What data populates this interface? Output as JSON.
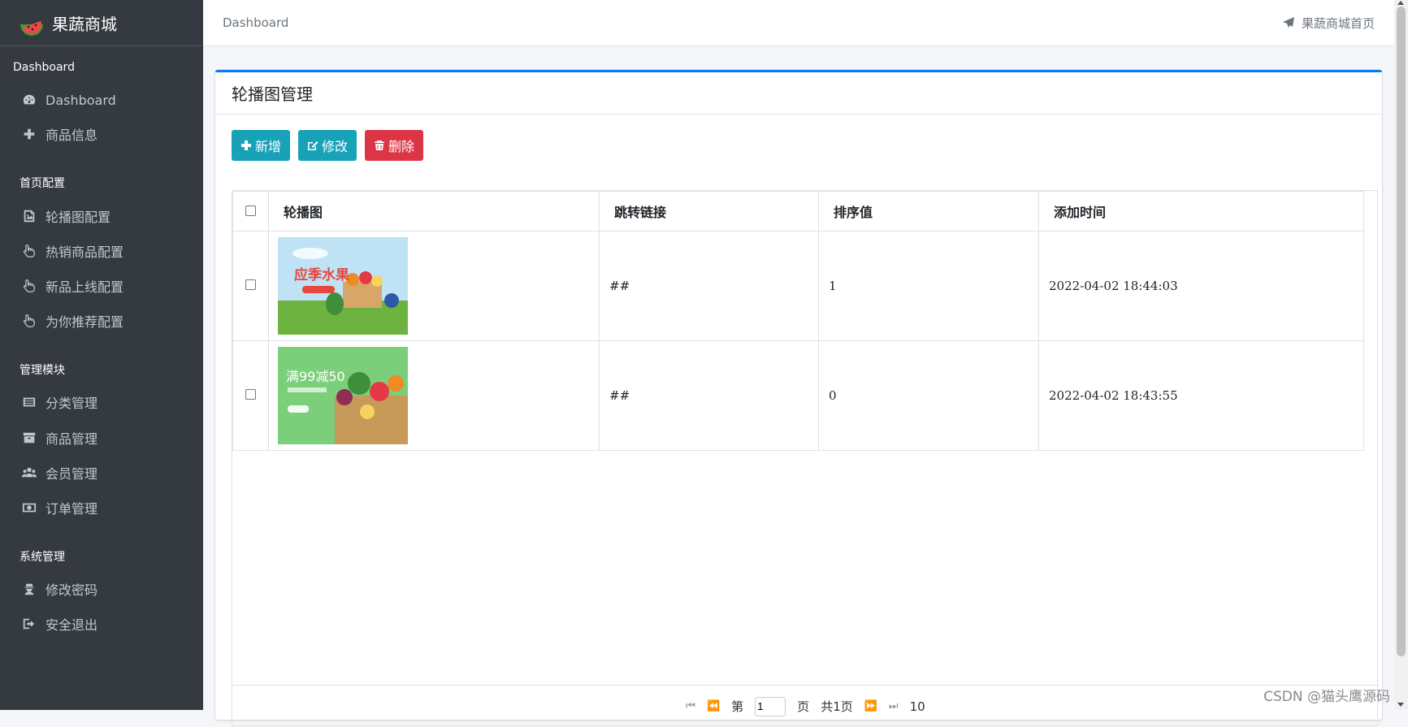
{
  "brand": {
    "name": "果蔬商城"
  },
  "sidebar": {
    "sections": [
      {
        "header": "Dashboard",
        "items": [
          {
            "label": "Dashboard",
            "icon": "dashboard-icon"
          },
          {
            "label": "商品信息",
            "icon": "plus-icon"
          }
        ]
      },
      {
        "header": "首页配置",
        "items": [
          {
            "label": "轮播图配置",
            "icon": "image-icon"
          },
          {
            "label": "热销商品配置",
            "icon": "hand-pointer-icon"
          },
          {
            "label": "新品上线配置",
            "icon": "hand-pointer-icon"
          },
          {
            "label": "为你推荐配置",
            "icon": "hand-pointer-icon"
          }
        ]
      },
      {
        "header": "管理模块",
        "items": [
          {
            "label": "分类管理",
            "icon": "list-icon"
          },
          {
            "label": "商品管理",
            "icon": "archive-icon"
          },
          {
            "label": "会员管理",
            "icon": "users-icon"
          },
          {
            "label": "订单管理",
            "icon": "money-icon"
          }
        ]
      },
      {
        "header": "系统管理",
        "items": [
          {
            "label": "修改密码",
            "icon": "user-secret-icon"
          },
          {
            "label": "安全退出",
            "icon": "sign-out-icon"
          }
        ]
      }
    ]
  },
  "topbar": {
    "breadcrumb": "Dashboard",
    "home_link": "果蔬商城首页"
  },
  "card": {
    "title": "轮播图管理",
    "buttons": {
      "add": "新增",
      "edit": "修改",
      "delete": "删除"
    }
  },
  "table": {
    "headers": [
      "轮播图",
      "跳转链接",
      "排序值",
      "添加时间"
    ],
    "rows": [
      {
        "image_label": "应季水果",
        "link": "##",
        "sort": "1",
        "time": "2022-04-02 18:44:03"
      },
      {
        "image_label": "满99减50",
        "link": "##",
        "sort": "0",
        "time": "2022-04-02 18:43:55"
      }
    ]
  },
  "pager": {
    "prefix": "第",
    "page": "1",
    "suffix": "页",
    "total": "共1页",
    "size": "10"
  },
  "watermark": "CSDN @猫头鹰源码",
  "colors": {
    "sidebar": "#343a40",
    "accent": "#007bff",
    "info": "#17a2b8",
    "danger": "#dc3545"
  }
}
